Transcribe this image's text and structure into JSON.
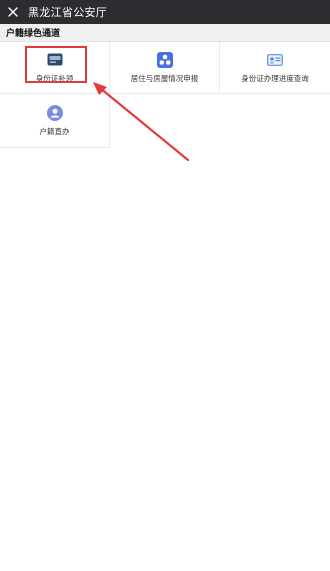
{
  "header": {
    "title": "黑龙江省公安厅",
    "close_icon": "close-icon"
  },
  "section": {
    "title": "户籍绿色通道"
  },
  "services": [
    {
      "label": "身份证补领",
      "icon": "id-card-icon",
      "color": "#2f4a6e"
    },
    {
      "label": "居住与房屋情况申报",
      "icon": "house-declaration-icon",
      "color": "#4a6fe3"
    },
    {
      "label": "身份证办理进度查询",
      "icon": "id-progress-query-icon",
      "color": "#5b8ed6"
    },
    {
      "label": "户籍直办",
      "icon": "household-user-icon",
      "color": "#7b8ce0"
    }
  ],
  "annotation_color": "#e23b3b"
}
